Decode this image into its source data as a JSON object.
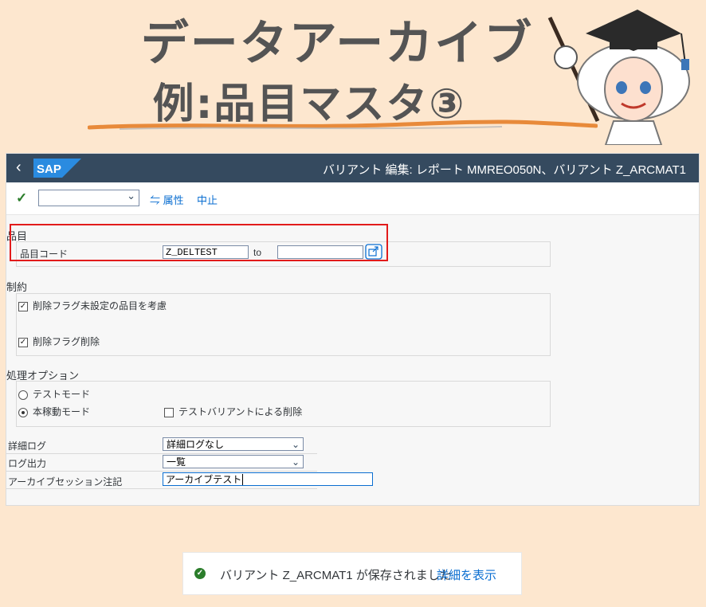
{
  "banner": {
    "title_line1": "データアーカイブ",
    "title_line2": "例:品目マスタ③"
  },
  "shell": {
    "back_icon": "chevron-left-icon",
    "logo": "SAP",
    "title": "バリアント 編集: レポート MMREO050N、バリアント Z_ARCMAT1"
  },
  "toolbar": {
    "confirm_icon": "checkmark-icon",
    "variant_select_value": "",
    "attributes_label": "属性",
    "cancel_label": "中止"
  },
  "sections": {
    "material": {
      "title": "品目",
      "field_label": "品目コード",
      "from_value": "Z_DELTEST",
      "to_label": "to",
      "to_value": ""
    },
    "restrictions": {
      "title": "制約",
      "opt1_label": "削除フラグ未設定の品目を考慮",
      "opt1_checked": true,
      "opt2_label": "削除フラグ削除",
      "opt2_checked": true
    },
    "processing": {
      "title": "処理オプション",
      "test_mode_label": "テストモード",
      "prod_mode_label": "本稼動モード",
      "selected_mode": "本稼動モード",
      "test_variant_label": "テストバリアントによる削除",
      "test_variant_checked": false
    }
  },
  "settings": {
    "detail_log_label": "詳細ログ",
    "detail_log_value": "詳細ログなし",
    "log_output_label": "ログ出力",
    "log_output_value": "一覧",
    "archive_note_label": "アーカイブセッション注記",
    "archive_note_value": "アーカイブテスト"
  },
  "toast": {
    "message": "バリアント Z_ARCMAT1 が保存されました",
    "link": "詳細を表示"
  },
  "colors": {
    "background": "#fde7cf",
    "shell": "#354a5f",
    "accent": "#0a6ed1",
    "highlight": "#e21b1b",
    "success": "#2b7d2b"
  }
}
